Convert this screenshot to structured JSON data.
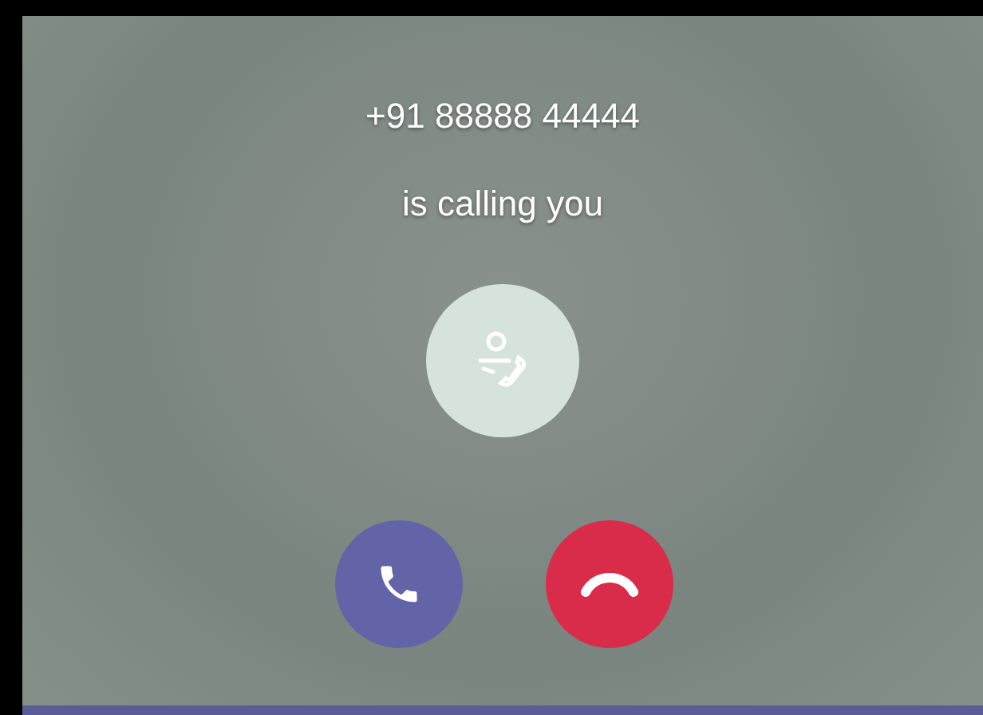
{
  "caller": {
    "number": "+91 88888 44444",
    "status": "is calling you"
  },
  "actions": [
    {
      "kind": "accept"
    },
    {
      "kind": "decline"
    }
  ]
}
